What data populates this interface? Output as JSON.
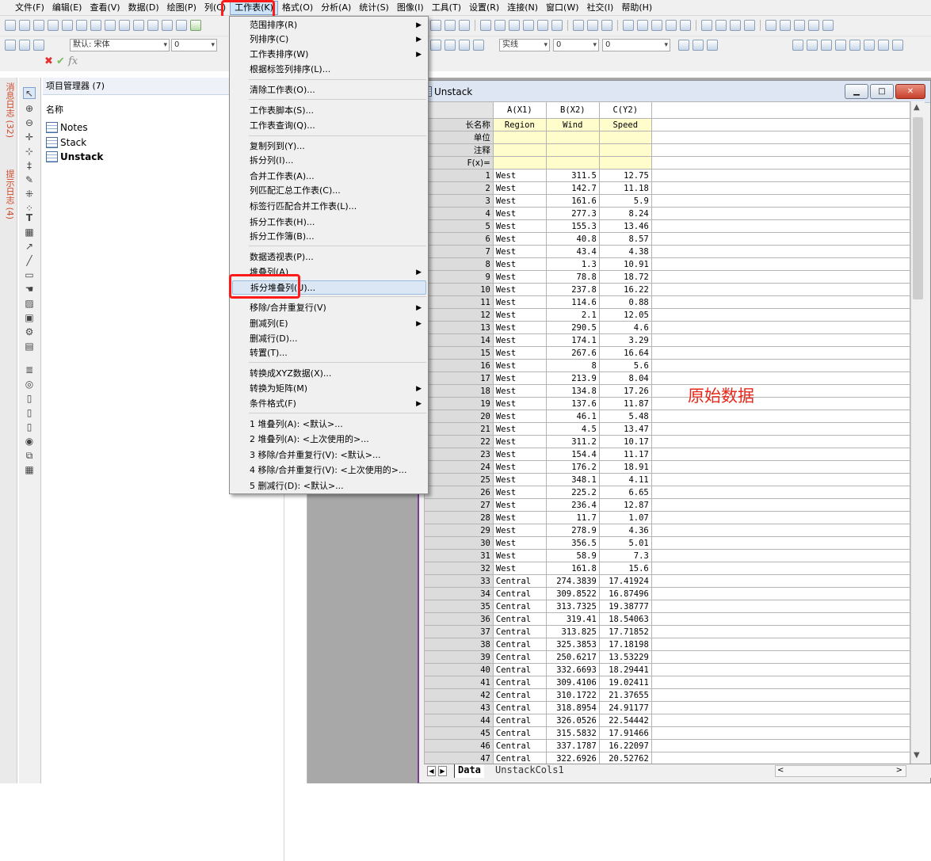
{
  "menubar": {
    "items": [
      "文件(F)",
      "编辑(E)",
      "查看(V)",
      "数据(D)",
      "绘图(P)",
      "列(C)",
      "工作表(K)",
      "格式(O)",
      "分析(A)",
      "统计(S)",
      "图像(I)",
      "工具(T)",
      "设置(R)",
      "连接(N)",
      "窗口(W)",
      "社交(I)",
      "帮助(H)"
    ],
    "active_index": 6
  },
  "toolbar": {
    "font_name": "默认: 宋体",
    "font_size": "0",
    "line_style": "实线",
    "line_width": "0",
    "line_width2": "0"
  },
  "side_tabs": {
    "messages": "消息日志 (32)",
    "hints": "提示日志 (4)"
  },
  "project_manager": {
    "title": "项目管理器 (7)",
    "column_header": "名称",
    "items": [
      {
        "name": "Notes",
        "selected": false
      },
      {
        "name": "Stack",
        "selected": false
      },
      {
        "name": "Unstack",
        "selected": true
      }
    ]
  },
  "worksheet_menu": {
    "items": [
      {
        "label": "范围排序(R)",
        "submenu": true
      },
      {
        "label": "列排序(C)",
        "submenu": true
      },
      {
        "label": "工作表排序(W)",
        "submenu": true
      },
      {
        "label": "根据标签列排序(L)...",
        "submenu": false
      },
      {
        "label": "清除工作表(O)...",
        "submenu": false
      },
      {
        "label": "工作表脚本(S)...",
        "submenu": false
      },
      {
        "label": "工作表查询(Q)...",
        "submenu": false
      },
      {
        "label": "复制列到(Y)...",
        "submenu": false
      },
      {
        "label": "拆分列(I)...",
        "submenu": false
      },
      {
        "label": "合并工作表(A)...",
        "submenu": false
      },
      {
        "label": "列匹配汇总工作表(C)...",
        "submenu": false
      },
      {
        "label": "标签行匹配合并工作表(L)...",
        "submenu": false
      },
      {
        "label": "拆分工作表(H)...",
        "submenu": false
      },
      {
        "label": "拆分工作簿(B)...",
        "submenu": false
      },
      {
        "label": "数据透视表(P)...",
        "submenu": false
      },
      {
        "label": "堆叠列(A)",
        "submenu": true
      },
      {
        "label": "拆分堆叠列(U)...",
        "submenu": false,
        "highlighted": true
      },
      {
        "label": "移除/合并重复行(V)",
        "submenu": true
      },
      {
        "label": "删减列(E)",
        "submenu": true
      },
      {
        "label": "删减行(D)...",
        "submenu": false
      },
      {
        "label": "转置(T)...",
        "submenu": false
      },
      {
        "label": "转换成XYZ数据(X)...",
        "submenu": false
      },
      {
        "label": "转换为矩阵(M)",
        "submenu": true
      },
      {
        "label": "条件格式(F)",
        "submenu": true
      },
      {
        "label": "1 堆叠列(A): <默认>...",
        "submenu": false
      },
      {
        "label": "2 堆叠列(A): <上次使用的>...",
        "submenu": false
      },
      {
        "label": "3 移除/合并重复行(V): <默认>...",
        "submenu": false
      },
      {
        "label": "4 移除/合并重复行(V): <上次使用的>...",
        "submenu": false
      },
      {
        "label": "5 删减行(D): <默认>...",
        "submenu": false
      }
    ]
  },
  "workbook": {
    "title": "Unstack",
    "columns": [
      "A(X1)",
      "B(X2)",
      "C(Y2)"
    ],
    "label_rows": [
      {
        "name": "长名称",
        "values": [
          "Region",
          "Wind",
          "Speed"
        ]
      },
      {
        "name": "单位",
        "values": [
          "",
          "",
          ""
        ]
      },
      {
        "name": "注释",
        "values": [
          "",
          "",
          ""
        ]
      },
      {
        "name": "F(x)=",
        "values": [
          "",
          "",
          ""
        ]
      }
    ],
    "rows": [
      [
        "1",
        "West",
        "311.5",
        "12.75"
      ],
      [
        "2",
        "West",
        "142.7",
        "11.18"
      ],
      [
        "3",
        "West",
        "161.6",
        "5.9"
      ],
      [
        "4",
        "West",
        "277.3",
        "8.24"
      ],
      [
        "5",
        "West",
        "155.3",
        "13.46"
      ],
      [
        "6",
        "West",
        "40.8",
        "8.57"
      ],
      [
        "7",
        "West",
        "43.4",
        "4.38"
      ],
      [
        "8",
        "West",
        "1.3",
        "10.91"
      ],
      [
        "9",
        "West",
        "78.8",
        "18.72"
      ],
      [
        "10",
        "West",
        "237.8",
        "16.22"
      ],
      [
        "11",
        "West",
        "114.6",
        "0.88"
      ],
      [
        "12",
        "West",
        "2.1",
        "12.05"
      ],
      [
        "13",
        "West",
        "290.5",
        "4.6"
      ],
      [
        "14",
        "West",
        "174.1",
        "3.29"
      ],
      [
        "15",
        "West",
        "267.6",
        "16.64"
      ],
      [
        "16",
        "West",
        "8",
        "5.6"
      ],
      [
        "17",
        "West",
        "213.9",
        "8.04"
      ],
      [
        "18",
        "West",
        "134.8",
        "17.26"
      ],
      [
        "19",
        "West",
        "137.6",
        "11.87"
      ],
      [
        "20",
        "West",
        "46.1",
        "5.48"
      ],
      [
        "21",
        "West",
        "4.5",
        "13.47"
      ],
      [
        "22",
        "West",
        "311.2",
        "10.17"
      ],
      [
        "23",
        "West",
        "154.4",
        "11.17"
      ],
      [
        "24",
        "West",
        "176.2",
        "18.91"
      ],
      [
        "25",
        "West",
        "348.1",
        "4.11"
      ],
      [
        "26",
        "West",
        "225.2",
        "6.65"
      ],
      [
        "27",
        "West",
        "236.4",
        "12.87"
      ],
      [
        "28",
        "West",
        "11.7",
        "1.07"
      ],
      [
        "29",
        "West",
        "278.9",
        "4.36"
      ],
      [
        "30",
        "West",
        "356.5",
        "5.01"
      ],
      [
        "31",
        "West",
        "58.9",
        "7.3"
      ],
      [
        "32",
        "West",
        "161.8",
        "15.6"
      ],
      [
        "33",
        "Central",
        "274.3839",
        "17.41924"
      ],
      [
        "34",
        "Central",
        "309.8522",
        "16.87496"
      ],
      [
        "35",
        "Central",
        "313.7325",
        "19.38777"
      ],
      [
        "36",
        "Central",
        "319.41",
        "18.54063"
      ],
      [
        "37",
        "Central",
        "313.825",
        "17.71852"
      ],
      [
        "38",
        "Central",
        "325.3853",
        "17.18198"
      ],
      [
        "39",
        "Central",
        "250.6217",
        "13.53229"
      ],
      [
        "40",
        "Central",
        "332.6693",
        "18.29441"
      ],
      [
        "41",
        "Central",
        "309.4106",
        "19.02411"
      ],
      [
        "42",
        "Central",
        "310.1722",
        "21.37655"
      ],
      [
        "43",
        "Central",
        "318.8954",
        "24.91177"
      ],
      [
        "44",
        "Central",
        "326.0526",
        "22.54442"
      ],
      [
        "45",
        "Central",
        "315.5832",
        "17.91466"
      ],
      [
        "46",
        "Central",
        "337.1787",
        "16.22097"
      ],
      [
        "47",
        "Central",
        "322.6926",
        "20.52762"
      ]
    ],
    "sheet_tabs": [
      "Data",
      "UnstackCols1"
    ],
    "active_sheet": "Data"
  },
  "annotation": "原始数据",
  "colors": {
    "highlight_box": "#ff1a1a",
    "label_row_bg": "#fffdcc",
    "annotation": "#e8281a"
  }
}
